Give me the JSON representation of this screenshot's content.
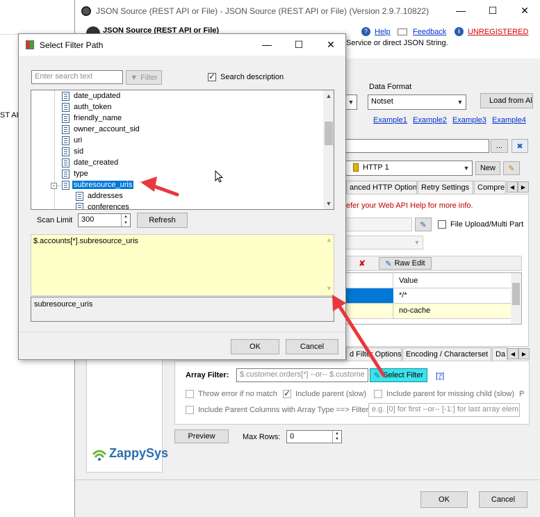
{
  "background_window": {
    "title_fragment": "ST AP"
  },
  "main_window": {
    "title": "JSON Source (REST API or File) - JSON Source (REST API or File) (Version 2.9.7.10822)",
    "header_title": "JSON Source (REST API or File)",
    "header_desc_fragment": "Service or direct JSON String.",
    "help_label": "Help",
    "feedback_label": "Feedback",
    "unregistered_label": "UNREGISTERED",
    "data_format_label": "Data Format",
    "data_format_value": "Notset",
    "load_from_label": "Load from Al",
    "examples": [
      "Example1",
      "Example2",
      "Example3",
      "Example4"
    ],
    "url_browse_label": "...",
    "connection_value": "HTTP 1",
    "new_label": "New",
    "http_tabs": [
      "anced HTTP Options",
      "Retry Settings",
      "Compre"
    ],
    "help_text": "efer your Web API Help for more info.",
    "file_upload_label": "File Upload/Multi Part",
    "raw_edit_label": "Raw Edit",
    "headers_table": {
      "value_header": "Value",
      "rows": [
        {
          "value": "*/*"
        },
        {
          "value": "no-cache"
        }
      ]
    },
    "filter_tabs": [
      "d Filter Options",
      "Encoding / Characterset",
      "Da"
    ],
    "array_filter_label": "Array Filter:",
    "array_filter_placeholder": "$.customer.orders[*] --or-- $.custome",
    "select_filter_label": "Select Filter",
    "help_link": "[?]",
    "throw_error_label": "Throw error if no match",
    "include_parent_label": "Include parent (slow)",
    "include_parent_missing_label": "Include parent for missing child (slow)",
    "include_parent_missing_trail": "P",
    "include_parent_cols_label": "Include Parent Columns with Array Type ==> Filter :",
    "parent_cols_placeholder": "e.g. [0] for first --or-- [-1:] for last array elem",
    "preview_label": "Preview",
    "max_rows_label": "Max Rows:",
    "max_rows_value": "0",
    "ok_label": "OK",
    "cancel_label": "Cancel",
    "logo_text": "ZappySys"
  },
  "dialog": {
    "title": "Select Filter Path",
    "search_placeholder": "Enter search text",
    "filter_label": "Filter",
    "search_description_label": "Search description",
    "search_description_checked": true,
    "tree_items": [
      {
        "label": "date_updated"
      },
      {
        "label": "auth_token"
      },
      {
        "label": "friendly_name"
      },
      {
        "label": "owner_account_sid"
      },
      {
        "label": "uri"
      },
      {
        "label": "sid"
      },
      {
        "label": "date_created"
      },
      {
        "label": "type"
      },
      {
        "label": "subresource_uris"
      },
      {
        "label": "addresses"
      },
      {
        "label": "conferences"
      }
    ],
    "selected_item": "subresource_uris",
    "scan_limit_label": "Scan Limit",
    "scan_limit_value": "300",
    "refresh_label": "Refresh",
    "path_value": "$.accounts[*].subresource_uris",
    "description_value": "subresource_uris",
    "ok_label": "OK",
    "cancel_label": "Cancel"
  },
  "colors": {
    "accent": "#0078d7",
    "annotation_arrow": "#e8383d",
    "path_bg": "#ffffc8",
    "select_filter_bg": "#3ee2ea"
  }
}
